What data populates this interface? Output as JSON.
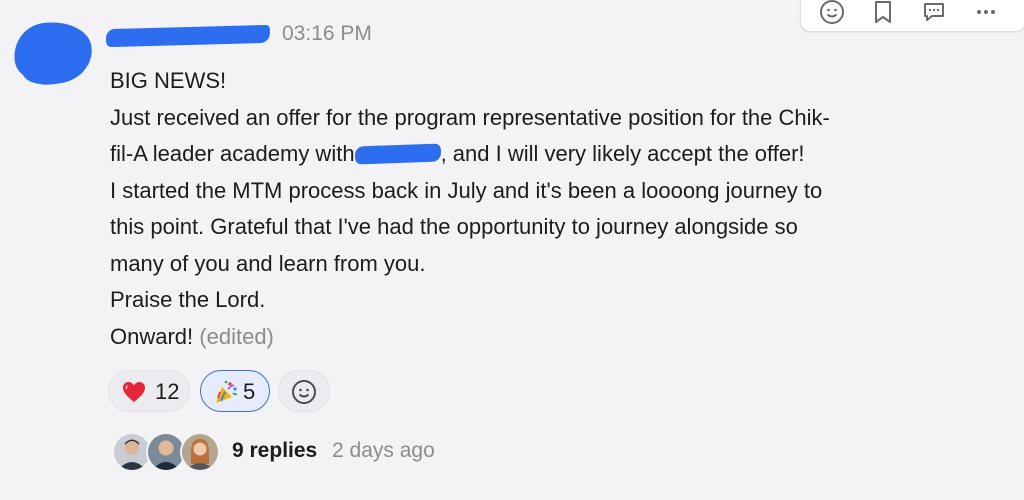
{
  "message": {
    "author": "",
    "timestamp": "03:16 PM",
    "lines": [
      "BIG NEWS!",
      "Just received an offer for the program representative position for the Chik-",
      "fil-A leader academy with",
      ", and I will very likely accept the offer!",
      "I started the MTM process back in July and it's been a loooong journey to",
      "this point. Grateful that I've had the opportunity to journey alongside so",
      "many of you and learn from you.",
      "Praise the Lord.",
      "Onward!"
    ],
    "edited_label": "(edited)"
  },
  "actions": [
    {
      "icon": "emoji-icon"
    },
    {
      "icon": "bookmark-icon"
    },
    {
      "icon": "reply-bubble-icon"
    },
    {
      "icon": "more-icon"
    }
  ],
  "reactions": [
    {
      "emoji": "heart-emoji",
      "count": "12",
      "active": false
    },
    {
      "emoji": "party-popper-emoji",
      "count": "5",
      "active": true
    }
  ],
  "add_reaction_icon": "add-reaction-icon",
  "thread": {
    "replies": "9 replies",
    "last_reply": "2 days ago"
  },
  "colors": {
    "background": "#f3f3f6",
    "text": "#1d1c1d",
    "muted": "#8b8b90",
    "accent": "#3f6fd8",
    "redaction": "#2d6df0"
  }
}
